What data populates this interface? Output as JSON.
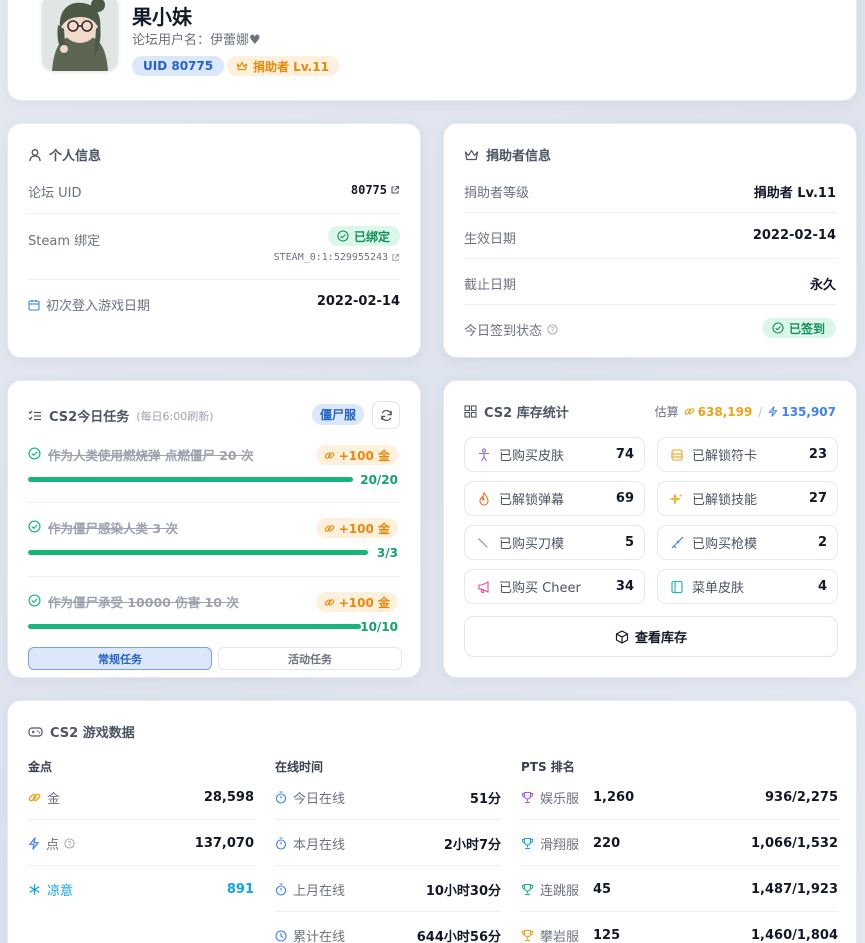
{
  "profile": {
    "name": "果小妹",
    "username_label": "论坛用户名：",
    "username": "伊蕾娜♥",
    "uid_badge": "UID 80775",
    "donor_badge": "捐助者 Lv.11"
  },
  "personal": {
    "title": "个人信息",
    "uid_label": "论坛 UID",
    "uid_value": "80775",
    "steam_label": "Steam 绑定",
    "steam_status": "已绑定",
    "steam_id": "STEAM_0:1:529955243",
    "first_login_label": "初次登入游戏日期",
    "first_login_value": "2022-02-14"
  },
  "donor": {
    "title": "捐助者信息",
    "rows": [
      {
        "label": "捐助者等级",
        "value": "捐助者 Lv.11"
      },
      {
        "label": "生效日期",
        "value": "2022-02-14"
      },
      {
        "label": "截止日期",
        "value": "永久"
      }
    ],
    "checkin_label": "今日签到状态",
    "checkin_value": "已签到"
  },
  "tasks": {
    "title": "CS2今日任务",
    "subtitle": "(每日6:00刷新)",
    "server_tag": "僵尸服",
    "items": [
      {
        "name": "作为人类使用燃烧弹 点燃僵尸 20 次",
        "reward": "+100 金",
        "progress": "20/20",
        "fraction": 1.0
      },
      {
        "name": "作为僵尸感染人类 3 次",
        "reward": "+100 金",
        "progress": "3/3",
        "fraction": 1.0
      },
      {
        "name": "作为僵尸承受 10000 伤害 10 次",
        "reward": "+100 金",
        "progress": "10/10",
        "fraction": 1.0
      }
    ],
    "tab_regular": "常规任务",
    "tab_event": "活动任务"
  },
  "inventory": {
    "title": "CS2 库存统计",
    "estimate_label": "估算",
    "gold_value": "638,199",
    "slash": "/",
    "point_value": "135,907",
    "items": [
      {
        "label": "已购买皮肤",
        "value": "74",
        "icon": "person-icon",
        "color": "#8b6cf0"
      },
      {
        "label": "已解锁符卡",
        "value": "23",
        "icon": "card-icon",
        "color": "#e8a317"
      },
      {
        "label": "已解锁弹幕",
        "value": "69",
        "icon": "flame-icon",
        "color": "#f26b1d"
      },
      {
        "label": "已解锁技能",
        "value": "27",
        "icon": "sparkle-icon",
        "color": "#e8b417"
      },
      {
        "label": "已购买刀模",
        "value": "5",
        "icon": "knife-icon",
        "color": "#6b7280"
      },
      {
        "label": "已购买枪模",
        "value": "2",
        "icon": "gun-icon",
        "color": "#3b82f6"
      },
      {
        "label": "已购买 Cheer",
        "value": "34",
        "icon": "megaphone-icon",
        "color": "#ec4899"
      },
      {
        "label": "菜单皮肤",
        "value": "4",
        "icon": "panel-icon",
        "color": "#14b8a6"
      }
    ],
    "view_button": "查看库存"
  },
  "gamedata": {
    "title": "CS2 游戏数据",
    "currency_head": "金点",
    "currency": [
      {
        "label": "金",
        "value": "28,598",
        "icon": "gold-icon",
        "color": "#e8a317"
      },
      {
        "label": "点",
        "value": "137,070",
        "icon": "bolt-icon",
        "color": "#3b82f6"
      },
      {
        "label": "凉意",
        "value": "891",
        "icon": "snow-icon",
        "color": "#0ea5e9"
      }
    ],
    "online_head": "在线时间",
    "online": [
      {
        "label": "今日在线",
        "value": "51分"
      },
      {
        "label": "本月在线",
        "value": "2小时7分"
      },
      {
        "label": "上月在线",
        "value": "10小时30分"
      },
      {
        "label": "累计在线",
        "value": "644小时56分"
      }
    ],
    "pts_head": "PTS 排名",
    "pts": [
      {
        "label": "娱乐服",
        "score": "1,260",
        "rank": "936/2,275",
        "color": "#a855f7"
      },
      {
        "label": "滑翔服",
        "score": "220",
        "rank": "1,066/1,532",
        "color": "#0ea5e9"
      },
      {
        "label": "连跳服",
        "score": "45",
        "rank": "1,487/1,923",
        "color": "#10b981"
      },
      {
        "label": "攀岩服",
        "score": "125",
        "rank": "1,460/1,804",
        "color": "#f59e0b"
      }
    ]
  }
}
